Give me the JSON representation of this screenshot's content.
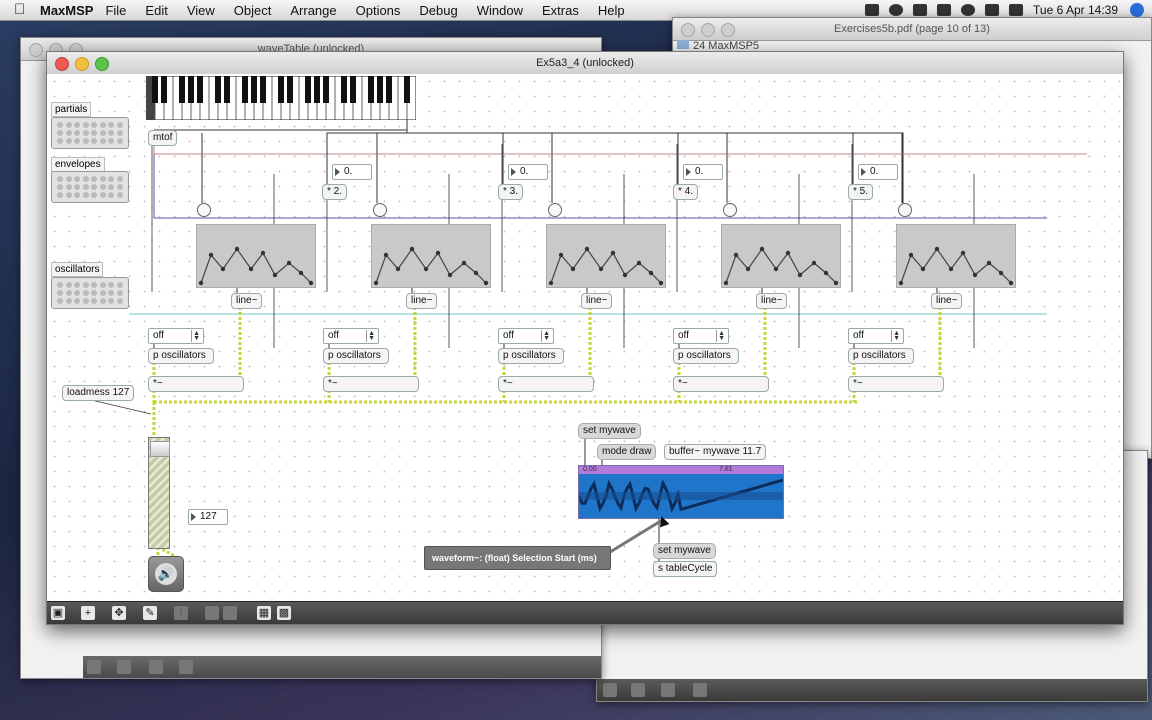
{
  "menubar": {
    "app_name": "MaxMSP",
    "items": [
      "File",
      "Edit",
      "View",
      "Object",
      "Arrange",
      "Options",
      "Debug",
      "Window",
      "Extras",
      "Help"
    ],
    "clock": "Tue 6 Apr  14:39"
  },
  "windows": {
    "back_left_title": "waveTable (unlocked)",
    "pdf_title": "Exercises5b.pdf (page 10 of 13)",
    "folder_title": "24 MaxMSP5",
    "main_title": "Ex5a3_4 (unlocked)"
  },
  "patch": {
    "labels": {
      "partials": "partials",
      "envelopes": "envelopes",
      "oscillators": "oscillators"
    },
    "mtof": "mtof",
    "multipliers": [
      "* 2.",
      "* 3.",
      "* 4.",
      "* 5."
    ],
    "number_default": "0.",
    "line_label": "line~",
    "menu_value": "off",
    "osc_label": "p oscillators",
    "mult_label": "*~",
    "loadmess": "loadmess 127",
    "gain_number": "127",
    "set_mywave": "set mywave",
    "mode_draw": "mode draw",
    "buffer": "buffer~ mywave 11.7",
    "waveform_start": "0.00",
    "waveform_end": "7.81",
    "tooltip": "waveform~: (float) Selection Start (ms)",
    "set_mywave_2": "set mywave",
    "send_table": "s tableCycle"
  }
}
